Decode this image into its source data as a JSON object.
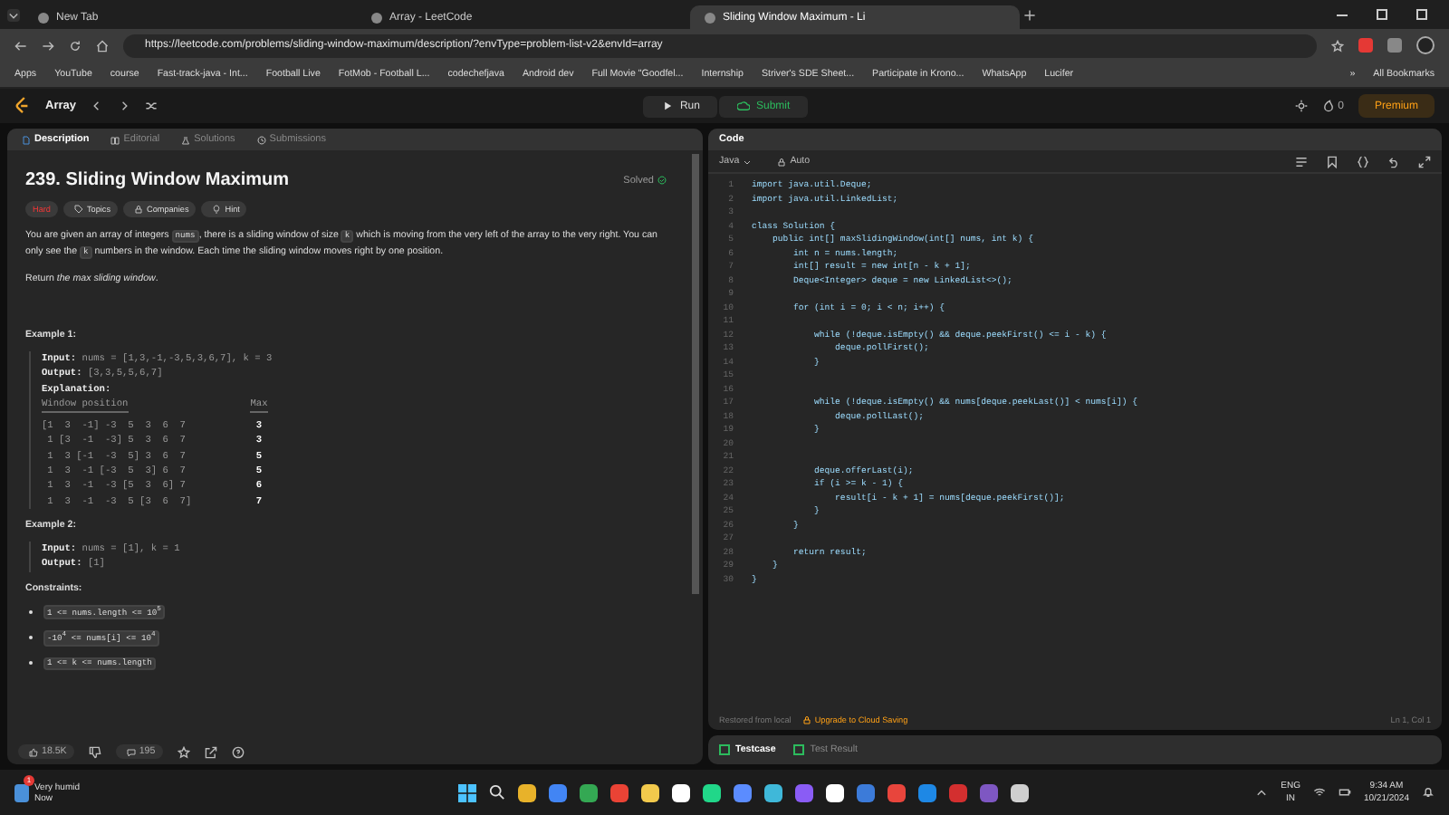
{
  "browser": {
    "tabs": [
      {
        "title": "New Tab",
        "selected": false
      },
      {
        "title": "Array - LeetCode",
        "selected": false
      },
      {
        "title": "Sliding Window Maximum - Li",
        "selected": true
      }
    ],
    "url": "https://leetcode.com/problems/sliding-window-maximum/description/?envType=problem-list-v2&envId=array",
    "bookmarks": [
      "Apps",
      "YouTube",
      "course",
      "Fast-track-java - Int...",
      "Football Live",
      "FotMob - Football L...",
      "codechefjava",
      "Android dev",
      "Full Movie \"Goodfel...",
      "Internship",
      "Striver's SDE Sheet...",
      "Participate in Krono...",
      "WhatsApp",
      "Lucifer"
    ],
    "more_bookmarks": "»",
    "all_bookmarks": "All Bookmarks"
  },
  "nav": {
    "list_name": "Array",
    "run": "Run",
    "submit": "Submit",
    "streak": "0",
    "premium": "Premium"
  },
  "problem": {
    "tabs": [
      {
        "label": "Description",
        "selected": true
      },
      {
        "label": "Editorial",
        "selected": false
      },
      {
        "label": "Solutions",
        "selected": false
      },
      {
        "label": "Submissions",
        "selected": false
      }
    ],
    "title": "239. Sliding Window Maximum",
    "status": "Solved",
    "tags": [
      {
        "label": "Hard",
        "kind": "difficulty"
      },
      {
        "label": "Topics",
        "kind": "topics"
      },
      {
        "label": "Companies",
        "kind": "companies"
      },
      {
        "label": "Hint",
        "kind": "hint"
      }
    ],
    "description": [
      {
        "kind": "text",
        "text": "You are given an array of integers "
      },
      {
        "kind": "code",
        "text": "nums"
      },
      {
        "kind": "text",
        "text": ", there is a sliding window of size "
      },
      {
        "kind": "code",
        "text": "k"
      },
      {
        "kind": "text",
        "text": " which is moving from the very left of the array to the very right. You can only see the "
      },
      {
        "kind": "code",
        "text": "k"
      },
      {
        "kind": "text",
        "text": " numbers in the window. Each time the sliding window moves right by one position."
      }
    ],
    "return_text": "Return *the max sliding window*.",
    "examples": [
      {
        "title": "Example 1:",
        "lines": [
          {
            "label": "Input:",
            "value": "nums = [1,3,-1,-3,5,3,6,7], k = 3"
          },
          {
            "label": "Output:",
            "value": "[3,3,5,5,6,7]"
          }
        ],
        "explanation": {
          "label": "Explanation:",
          "column_1": "Window position",
          "column_2": "Max",
          "rows": [
            {
              "window": "[1  3  -1] -3  5  3  6  7",
              "max": "3"
            },
            {
              "window": " 1 [3  -1  -3] 5  3  6  7",
              "max": "3"
            },
            {
              "window": " 1  3 [-1  -3  5] 3  6  7",
              "max": "5"
            },
            {
              "window": " 1  3  -1 [-3  5  3] 6  7",
              "max": "5"
            },
            {
              "window": " 1  3  -1  -3 [5  3  6] 7",
              "max": "6"
            },
            {
              "window": " 1  3  -1  -3  5 [3  6  7]",
              "max": "7"
            }
          ]
        }
      },
      {
        "title": "Example 2:",
        "lines": [
          {
            "label": "Input:",
            "value": "nums = [1], k = 1"
          },
          {
            "label": "Output:",
            "value": "[1]"
          }
        ]
      }
    ],
    "constraints_title": "Constraints:",
    "constraints": [
      "1 <= nums.length <= 10$^{5}$",
      "-10$^{4}$ <= nums[i] <= 10$^{4}$",
      "1 <= k <= nums.length"
    ],
    "likes": "18.5K",
    "comments": "195"
  },
  "editor": {
    "title": "Code",
    "language": "Java",
    "mode": "Auto",
    "lines": [
      {
        "number": "1",
        "code": "import java.util.Deque;"
      },
      {
        "number": "2",
        "code": "import java.util.LinkedList;"
      },
      {
        "number": "3"
      },
      {
        "number": "4",
        "code": "class Solution {"
      },
      {
        "number": "5",
        "code": "    public int[] maxSlidingWindow(int[] nums, int k) {"
      },
      {
        "number": "6",
        "code": "        int n = nums.length;"
      },
      {
        "number": "7",
        "code": "        int[] result = new int[n - k + 1];"
      },
      {
        "number": "8",
        "code": "        Deque<Integer> deque = new LinkedList<>();"
      },
      {
        "number": "9"
      },
      {
        "number": "10",
        "code": "        for (int i = 0; i < n; i++) {"
      },
      {
        "number": "11"
      },
      {
        "number": "12",
        "code": "            while (!deque.isEmpty() && deque.peekFirst() <= i - k) {"
      },
      {
        "number": "13",
        "code": "                deque.pollFirst();"
      },
      {
        "number": "14",
        "code": "            }"
      },
      {
        "number": "15"
      },
      {
        "number": "16"
      },
      {
        "number": "17",
        "code": "            while (!deque.isEmpty() && nums[deque.peekLast()] < nums[i]) {"
      },
      {
        "number": "18",
        "code": "                deque.pollLast();"
      },
      {
        "number": "19",
        "code": "            }"
      },
      {
        "number": "20"
      },
      {
        "number": "21"
      },
      {
        "number": "22",
        "code": "            deque.offerLast(i);"
      },
      {
        "number": "23",
        "code": "            if (i >= k - 1) {"
      },
      {
        "number": "24",
        "code": "                result[i - k + 1] = nums[deque.peekFirst()];"
      },
      {
        "number": "25",
        "code": "            }"
      },
      {
        "number": "26",
        "code": "        }"
      },
      {
        "number": "27"
      },
      {
        "number": "28",
        "code": "        return result;"
      },
      {
        "number": "29",
        "code": "    }"
      },
      {
        "number": "30",
        "code": "}"
      }
    ],
    "restored": "Restored from local",
    "upgrade": "Upgrade to Cloud Saving",
    "cursor": "Ln 1, Col 1",
    "bottom_tabs": [
      {
        "label": "Testcase",
        "selected": true
      },
      {
        "label": "Test Result",
        "selected": false
      }
    ]
  },
  "taskbar": {
    "weather": "Very humid",
    "weather_time": "Now",
    "badge": "1",
    "lang": "ENG",
    "region": "IN",
    "time": "9:34 AM",
    "date": "10/21/2024"
  }
}
